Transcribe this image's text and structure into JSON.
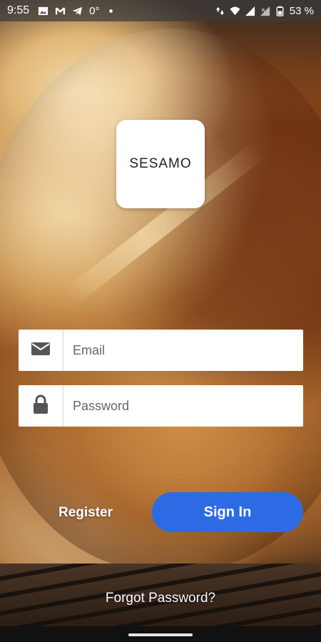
{
  "status_bar": {
    "time": "9:55",
    "notification_icons": [
      "image-icon",
      "gmail-icon",
      "telegram-icon",
      "temperature-icon",
      "dot-icon"
    ],
    "temperature": "0°",
    "right_icons": [
      "data-arrows-icon",
      "wifi-icon",
      "signal-icon",
      "signal-roaming-icon",
      "battery-icon"
    ],
    "battery": "53 %"
  },
  "app": {
    "logo_text": "SESAMO"
  },
  "login_form": {
    "email_placeholder": "Email",
    "email_value": "",
    "password_placeholder": "Password",
    "password_value": "",
    "email_icon": "envelope-icon",
    "password_icon": "lock-icon"
  },
  "actions": {
    "register_label": "Register",
    "signin_label": "Sign In",
    "forgot_password_label": "Forgot Password?"
  },
  "colors": {
    "signin_button": "#2d6be4",
    "field_background": "#ffffff",
    "icon_color": "#555555"
  }
}
